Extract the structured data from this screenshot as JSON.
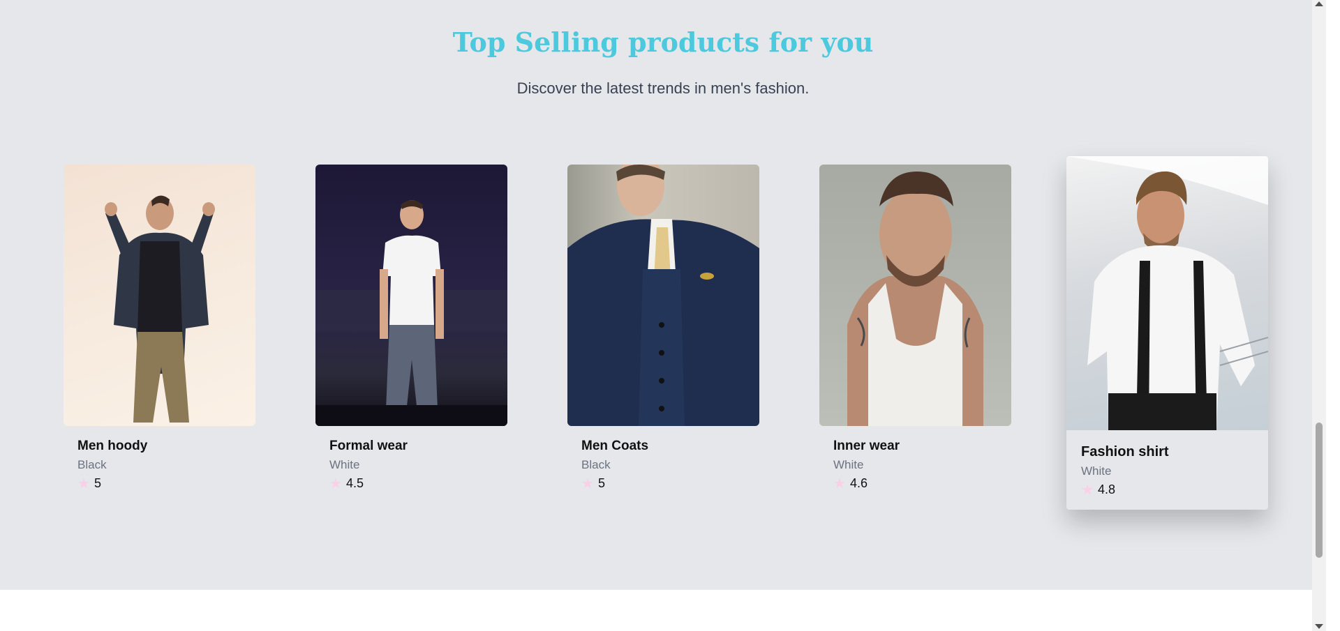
{
  "section": {
    "title": "Top Selling products for you",
    "subtitle": "Discover the latest trends in men's fashion."
  },
  "products": [
    {
      "name": "Men hoody",
      "color": "Black",
      "rating": "5",
      "image": "man in denim jacket and khaki pants"
    },
    {
      "name": "Formal wear",
      "color": "White",
      "rating": "4.5",
      "image": "man in white shirt and grey trousers on stage"
    },
    {
      "name": "Men Coats",
      "color": "Black",
      "rating": "5",
      "image": "man in navy three-piece suit"
    },
    {
      "name": "Inner wear",
      "color": "White",
      "rating": "4.6",
      "image": "man in white tank top"
    },
    {
      "name": "Fashion shirt",
      "color": "White",
      "rating": "4.8",
      "image": "man in white shirt with black tie"
    }
  ],
  "icons": {
    "rating": "star-icon"
  },
  "colors": {
    "title": "#4cc9dc",
    "star": "#fbcfe8",
    "section_bg": "#e5e7eb"
  }
}
